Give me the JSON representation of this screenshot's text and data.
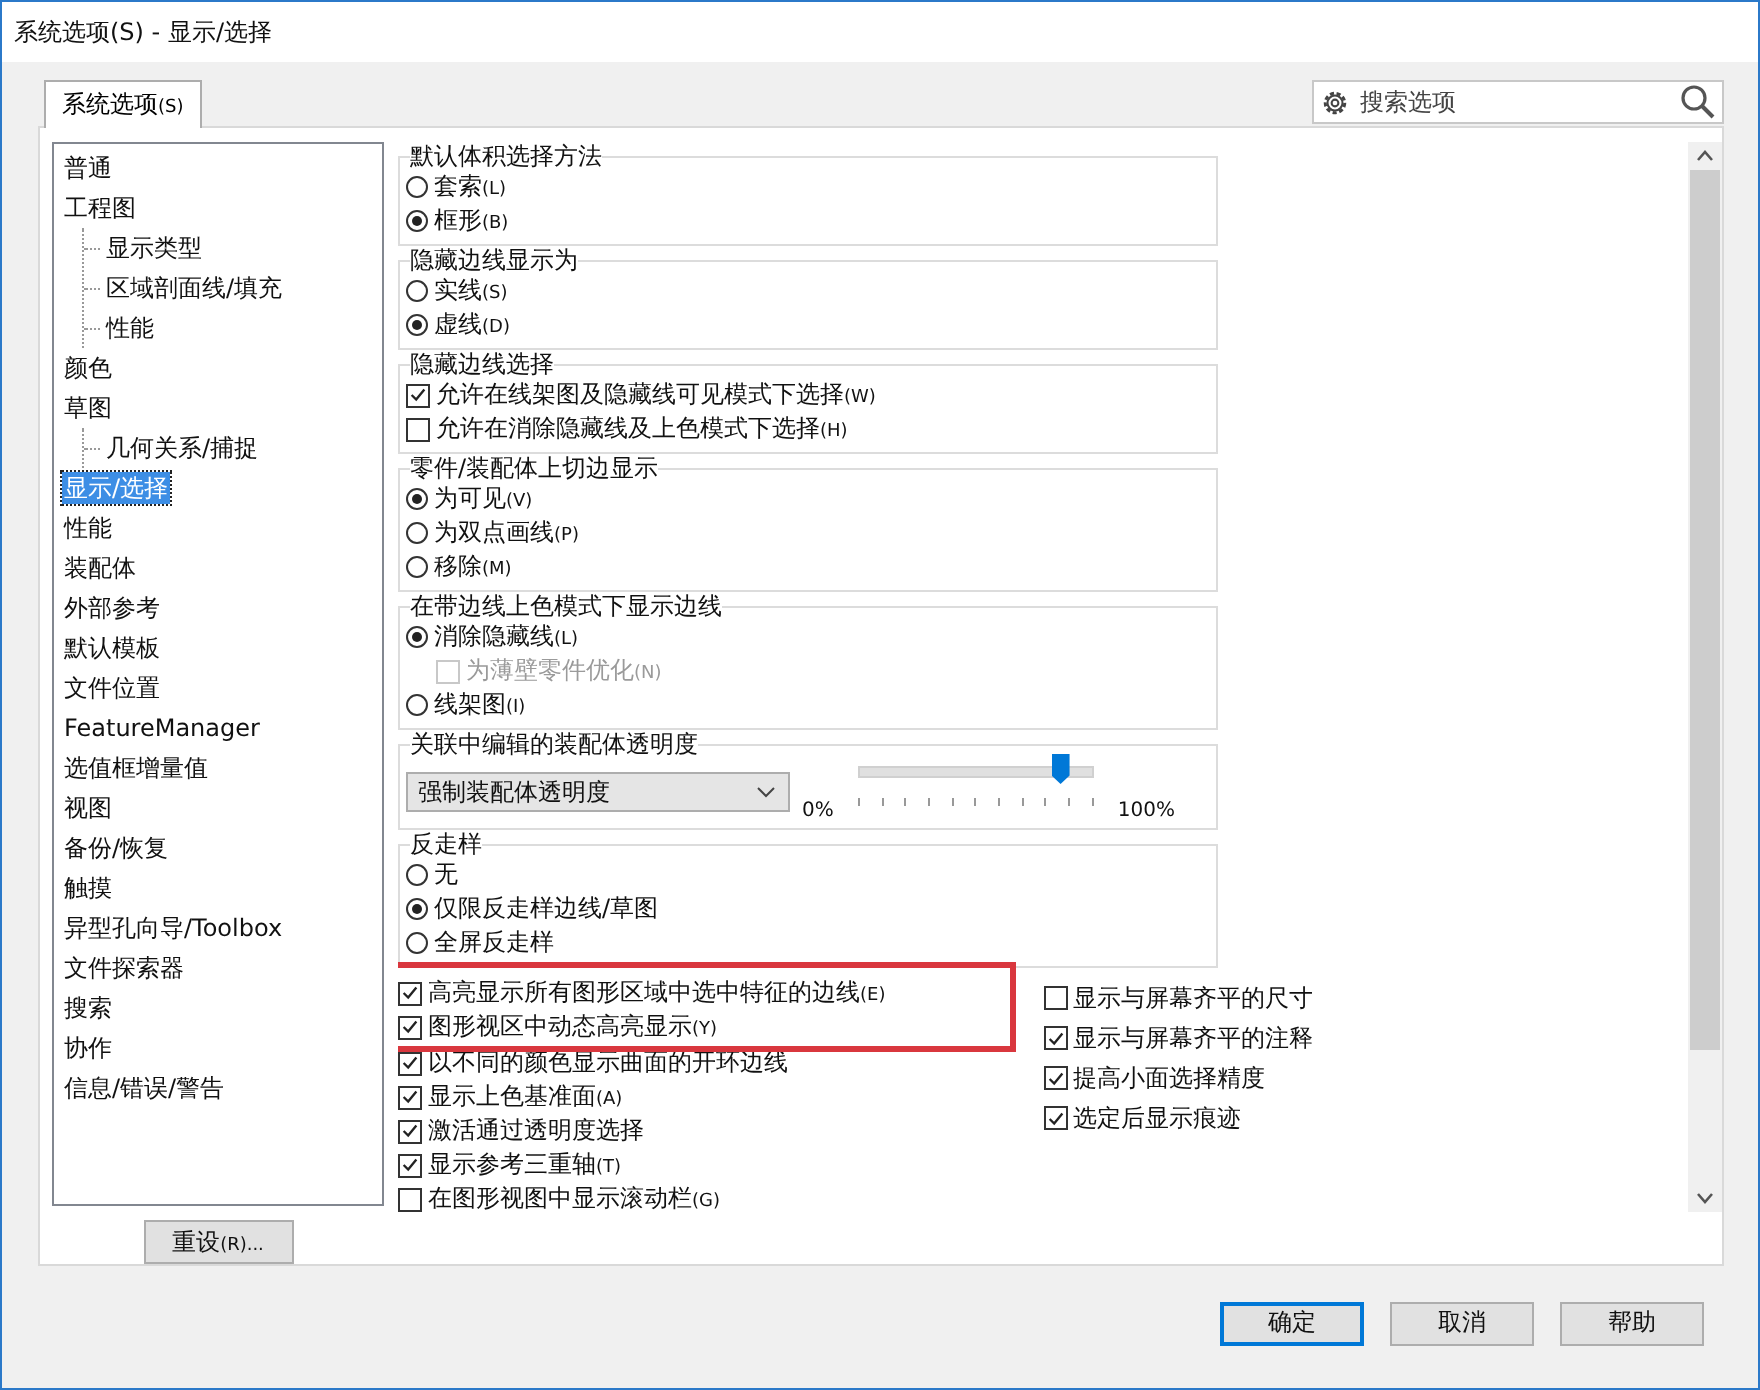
{
  "window": {
    "title": "系统选项(S) - 显示/选择"
  },
  "tabs": [
    {
      "label": "系统选项",
      "key": "(S)",
      "selected": true
    }
  ],
  "search": {
    "placeholder": "搜索选项"
  },
  "sidebar": {
    "items": [
      {
        "label": "普通",
        "selected": false
      },
      {
        "label": "工程图",
        "selected": false,
        "children": [
          {
            "label": "显示类型",
            "selected": false
          },
          {
            "label": "区域剖面线/填充",
            "selected": false
          },
          {
            "label": "性能",
            "selected": false
          }
        ]
      },
      {
        "label": "颜色",
        "selected": false
      },
      {
        "label": "草图",
        "selected": false,
        "children": [
          {
            "label": "几何关系/捕捉",
            "selected": false
          }
        ]
      },
      {
        "label": "显示/选择",
        "selected": true
      },
      {
        "label": "性能",
        "selected": false
      },
      {
        "label": "装配体",
        "selected": false
      },
      {
        "label": "外部参考",
        "selected": false
      },
      {
        "label": "默认模板",
        "selected": false
      },
      {
        "label": "文件位置",
        "selected": false
      },
      {
        "label": "FeatureManager",
        "selected": false
      },
      {
        "label": "选值框增量值",
        "selected": false
      },
      {
        "label": "视图",
        "selected": false
      },
      {
        "label": "备份/恢复",
        "selected": false
      },
      {
        "label": "触摸",
        "selected": false
      },
      {
        "label": "异型孔向导/Toolbox",
        "selected": false
      },
      {
        "label": "文件探索器",
        "selected": false
      },
      {
        "label": "搜索",
        "selected": false
      },
      {
        "label": "协作",
        "selected": false
      },
      {
        "label": "信息/错误/警告",
        "selected": false
      }
    ]
  },
  "groups": [
    {
      "title": "默认体积选择方法",
      "kind": "options",
      "options": [
        {
          "kind": "radio",
          "label": "套索",
          "key": "(L)",
          "selected": false
        },
        {
          "kind": "radio",
          "label": "框形",
          "key": "(B)",
          "selected": true
        }
      ]
    },
    {
      "title": "隐藏边线显示为",
      "kind": "options",
      "options": [
        {
          "kind": "radio",
          "label": "实线",
          "key": "(S)",
          "selected": false
        },
        {
          "kind": "radio",
          "label": "虚线",
          "key": "(D)",
          "selected": true
        }
      ]
    },
    {
      "title": "隐藏边线选择",
      "kind": "options",
      "options": [
        {
          "kind": "checkbox",
          "label": "允许在线架图及隐藏线可见模式下选择",
          "key": "(W)",
          "checked": true
        },
        {
          "kind": "checkbox",
          "label": "允许在消除隐藏线及上色模式下选择",
          "key": "(H)",
          "checked": false
        }
      ]
    },
    {
      "title": "零件/装配体上切边显示",
      "kind": "options",
      "options": [
        {
          "kind": "radio",
          "label": "为可见",
          "key": "(V)",
          "selected": true
        },
        {
          "kind": "radio",
          "label": "为双点画线",
          "key": "(P)",
          "selected": false
        },
        {
          "kind": "radio",
          "label": "移除",
          "key": "(M)",
          "selected": false
        }
      ]
    },
    {
      "title": "在带边线上色模式下显示边线",
      "kind": "options",
      "options": [
        {
          "kind": "radio",
          "label": "消除隐藏线",
          "key": "(L)",
          "selected": true,
          "children": [
            {
              "label": "为薄壁零件优化",
              "key": "(N)",
              "checked": false,
              "disabled": true
            }
          ]
        },
        {
          "kind": "radio",
          "label": "线架图",
          "key": "(I)",
          "selected": false
        }
      ]
    },
    {
      "title": "关联中编辑的装配体透明度",
      "kind": "transparency",
      "dropdown": "强制装配体透明度",
      "min_label": "0%",
      "max_label": "100%",
      "level": 0.87
    },
    {
      "title": "反走样",
      "kind": "options",
      "options": [
        {
          "kind": "radio",
          "label": "无",
          "selected": false
        },
        {
          "kind": "radio",
          "label": "仅限反走样边线/草图",
          "selected": true
        },
        {
          "kind": "radio",
          "label": "全屏反走样",
          "selected": false
        }
      ]
    }
  ],
  "left_checks": [
    {
      "label": "高亮显示所有图形区域中选中特征的边线",
      "key": "(E)",
      "checked": true,
      "highlighted": true
    },
    {
      "label": "图形视区中动态高亮显示",
      "key": "(Y)",
      "checked": true,
      "highlighted": true
    },
    {
      "label": "以不同的颜色显示曲面的开环边线",
      "checked": true,
      "highlighted": false
    },
    {
      "label": "显示上色基准面",
      "key": "(A)",
      "checked": true,
      "highlighted": false
    },
    {
      "label": "激活通过透明度选择",
      "checked": true,
      "highlighted": false
    },
    {
      "label": "显示参考三重轴",
      "key": "(T)",
      "checked": true,
      "highlighted": false
    },
    {
      "label": "在图形视图中显示滚动栏",
      "key": "(G)",
      "checked": false,
      "highlighted": false
    }
  ],
  "right_checks": [
    {
      "label": "显示与屏幕齐平的尺寸",
      "checked": false
    },
    {
      "label": "显示与屏幕齐平的注释",
      "checked": true
    },
    {
      "label": "提高小面选择精度",
      "checked": true
    },
    {
      "label": "选定后显示痕迹",
      "checked": true
    }
  ],
  "reset_button": {
    "label": "重设",
    "key": "(R)..."
  },
  "buttons": [
    {
      "label": "确定",
      "default": true
    },
    {
      "label": "取消",
      "default": false
    },
    {
      "label": "帮助",
      "default": false
    }
  ]
}
